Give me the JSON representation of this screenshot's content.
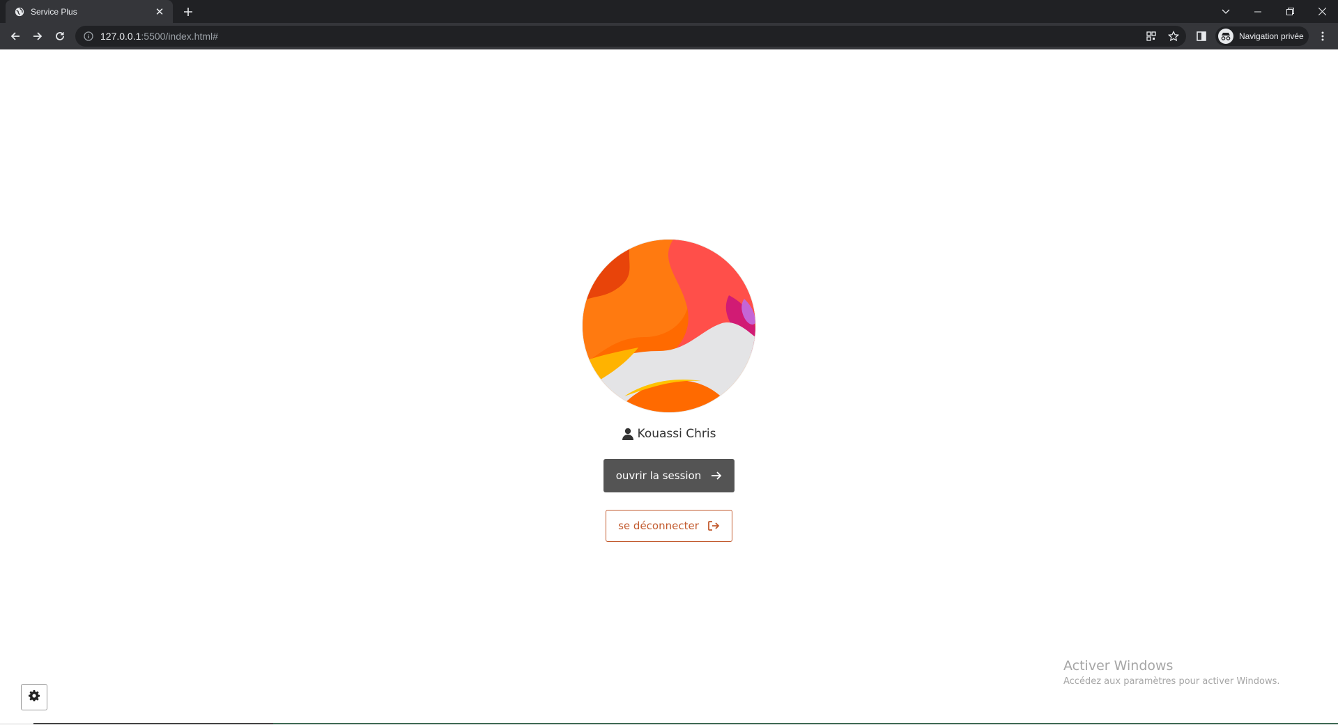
{
  "browser": {
    "tab_title": "Service Plus",
    "url_host": "127.0.0.1",
    "url_rest": ":5500/index.html#",
    "profile_label": "Navigation privée"
  },
  "user": {
    "name": "Kouassi Chris"
  },
  "actions": {
    "open_session_label": "ouvrir la session",
    "logout_label": "se déconnecter"
  },
  "windows_activation": {
    "title": "Activer Windows",
    "subtitle": "Accédez aux paramètres pour activer Windows."
  },
  "colors": {
    "primary_button": "#545454",
    "logout_accent": "#c25a2e"
  },
  "icons": {
    "user": "user-icon",
    "open": "arrow-right-icon",
    "logout": "logout-icon",
    "settings": "gear-icon"
  }
}
